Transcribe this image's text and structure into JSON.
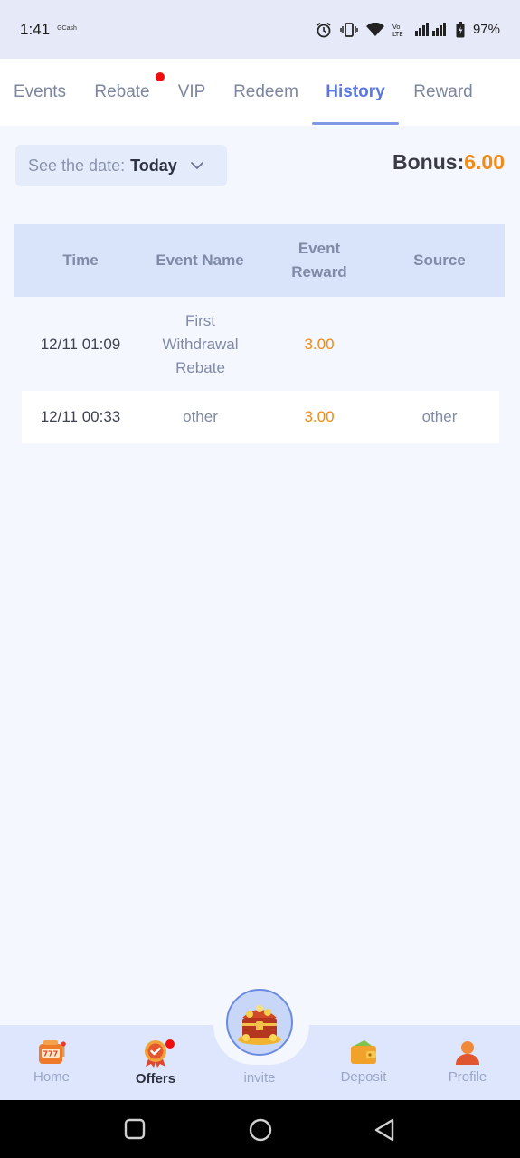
{
  "status_bar": {
    "time": "1:41",
    "app_name": "GCash",
    "battery": "97%"
  },
  "tabs": [
    {
      "label": "Events",
      "active": false
    },
    {
      "label": "Rebate",
      "active": false,
      "badge": true
    },
    {
      "label": "VIP",
      "active": false
    },
    {
      "label": "Redeem",
      "active": false
    },
    {
      "label": "History",
      "active": true
    },
    {
      "label": "Reward",
      "active": false
    }
  ],
  "filter": {
    "label": "See the date:",
    "value": "Today",
    "icon": "chevron-down-icon"
  },
  "bonus": {
    "label": "Bonus:",
    "value": "6.00"
  },
  "table": {
    "headers": [
      "Time",
      "Event Name",
      "Event\nReward",
      "Source"
    ],
    "rows": [
      {
        "time": "12/11 01:09",
        "event_name": "First Withdrawal Rebate",
        "reward": "3.00",
        "source": ""
      },
      {
        "time": "12/11 00:33",
        "event_name": "other",
        "reward": "3.00",
        "source": "other"
      }
    ]
  },
  "bottom_nav": {
    "items": [
      {
        "label": "Home",
        "icon": "slot-machine-icon",
        "active": false
      },
      {
        "label": "Offers",
        "icon": "medal-icon",
        "active": true,
        "badge": true
      },
      {
        "label": "invite",
        "icon": "treasure-chest-icon",
        "active": false
      },
      {
        "label": "Deposit",
        "icon": "wallet-icon",
        "active": false
      },
      {
        "label": "Profile",
        "icon": "user-icon",
        "active": false
      }
    ]
  },
  "colors": {
    "accent": "#5b77e0",
    "reward": "#f28a16",
    "badge": "#f00d0d"
  }
}
